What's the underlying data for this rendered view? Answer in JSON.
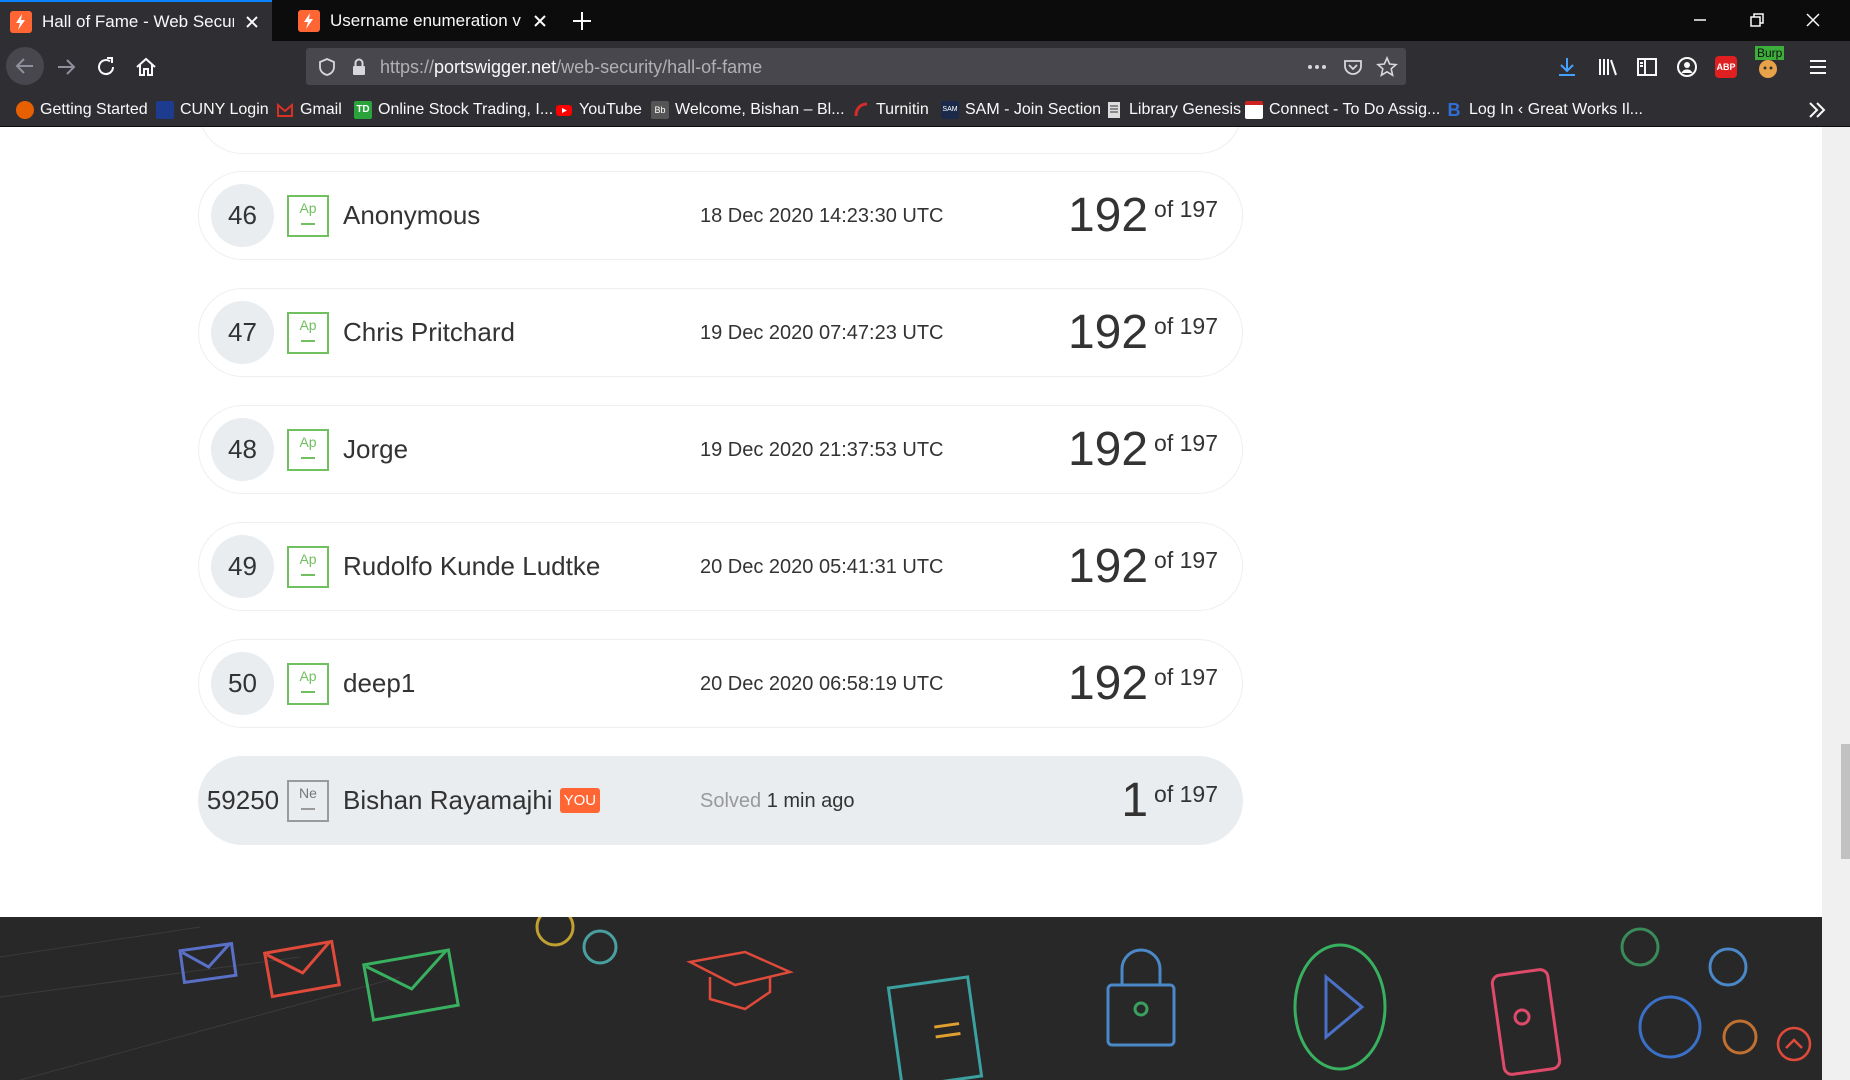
{
  "browser": {
    "tabs": [
      {
        "title": "Hall of Fame - Web Security Ac",
        "active": true
      },
      {
        "title": "Username enumeration via diffe",
        "active": false
      }
    ],
    "url": {
      "prefix": "https://",
      "domain": "portswigger.net",
      "path": "/web-security/hall-of-fame"
    },
    "bookmarks": [
      {
        "label": "Getting Started",
        "icon": "firefox-icon",
        "color": "#e66000"
      },
      {
        "label": "CUNY Login",
        "icon": "cuny-icon",
        "color": "#1d3c8f"
      },
      {
        "label": "Gmail",
        "icon": "gmail-icon",
        "color": "#d93025"
      },
      {
        "label": "Online Stock Trading, I...",
        "icon": "td-icon",
        "color": "#2aa33b"
      },
      {
        "label": "YouTube",
        "icon": "youtube-icon",
        "color": "#ff0000"
      },
      {
        "label": "Welcome, Bishan – Bl...",
        "icon": "blackboard-icon",
        "color": "#444444"
      },
      {
        "label": "Turnitin",
        "icon": "turnitin-icon",
        "color": "#d72b2b"
      },
      {
        "label": "SAM - Join Section",
        "icon": "sam-icon",
        "color": "#1b2a4a"
      },
      {
        "label": "Library Genesis",
        "icon": "document-icon",
        "color": "#dddddd"
      },
      {
        "label": "Connect - To Do Assig...",
        "icon": "connect-icon",
        "color": "#cc2222"
      },
      {
        "label": "Log In ‹ Great Works Il...",
        "icon": "b-icon",
        "color": "#2f6fd6"
      }
    ],
    "extension_badge": "Burp",
    "abp_label": "ABP"
  },
  "leaderboard": {
    "rows": [
      {
        "rank": "46",
        "level": "Ap",
        "name": "Anonymous",
        "date": "18 Dec 2020 14:23:30 UTC",
        "score": "192",
        "of": "of 197"
      },
      {
        "rank": "47",
        "level": "Ap",
        "name": "Chris Pritchard",
        "date": "19 Dec 2020 07:47:23 UTC",
        "score": "192",
        "of": "of 197"
      },
      {
        "rank": "48",
        "level": "Ap",
        "name": "Jorge",
        "date": "19 Dec 2020 21:37:53 UTC",
        "score": "192",
        "of": "of 197"
      },
      {
        "rank": "49",
        "level": "Ap",
        "name": "Rudolfo Kunde Ludtke",
        "date": "20 Dec 2020 05:41:31 UTC",
        "score": "192",
        "of": "of 197"
      },
      {
        "rank": "50",
        "level": "Ap",
        "name": "deep1",
        "date": "20 Dec 2020 06:58:19 UTC",
        "score": "192",
        "of": "of 197"
      }
    ],
    "you": {
      "rank": "59250",
      "level": "Ne",
      "name": "Bishan Rayamajhi",
      "badge": "YOU",
      "solved_label": "Solved",
      "solved_time": "1 min ago",
      "score": "1",
      "of": "of 197"
    }
  },
  "colors": {
    "accent_orange": "#ff6633",
    "apprentice_green": "#70c060",
    "footer_bg": "#282828"
  }
}
